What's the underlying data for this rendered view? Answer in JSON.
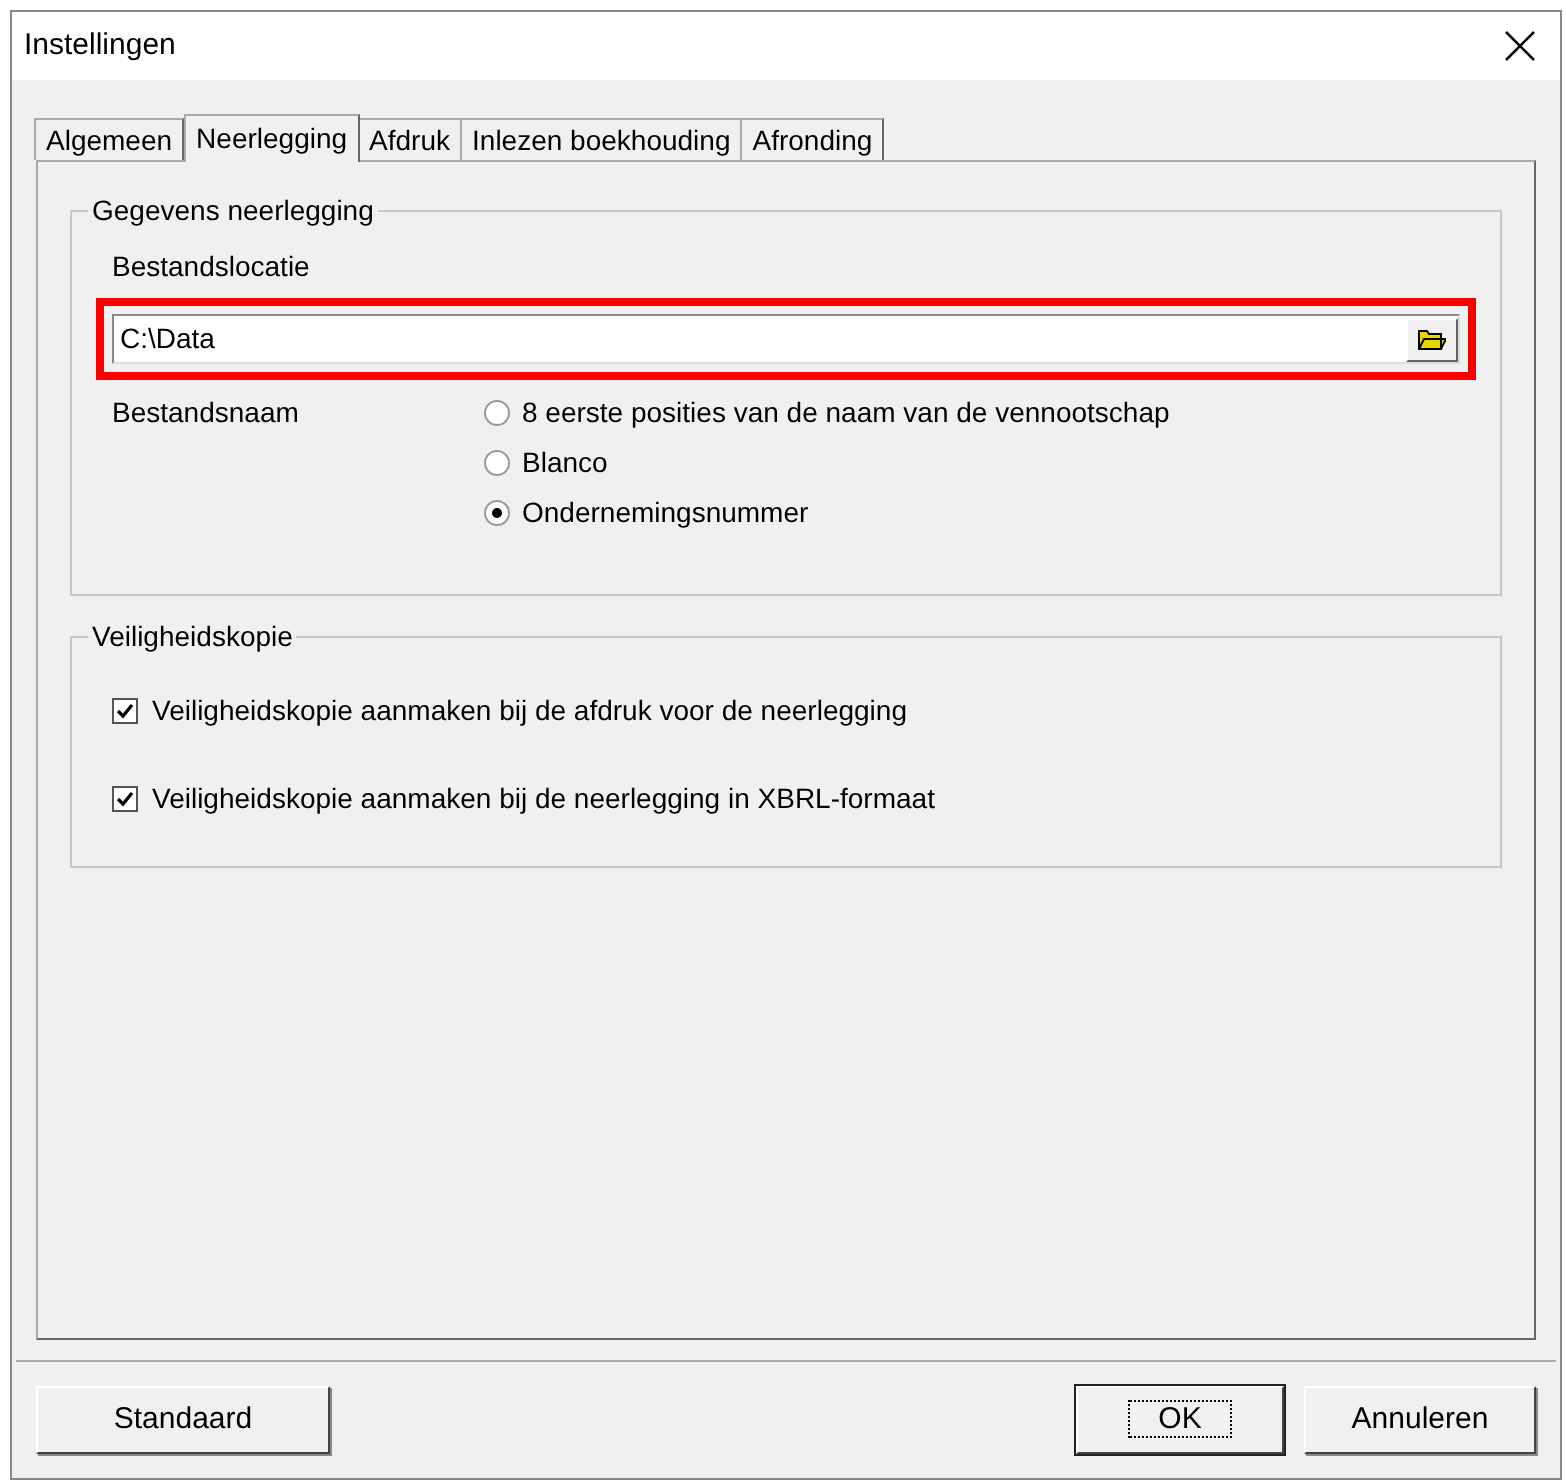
{
  "window": {
    "title": "Instellingen"
  },
  "tabs": [
    {
      "label": "Algemeen",
      "selected": false
    },
    {
      "label": "Neerlegging",
      "selected": true
    },
    {
      "label": "Afdruk",
      "selected": false
    },
    {
      "label": "Inlezen boekhouding",
      "selected": false
    },
    {
      "label": "Afronding",
      "selected": false
    }
  ],
  "group_1": {
    "title": "Gegevens neerlegging",
    "location_label": "Bestandslocatie",
    "location_field": {
      "value": "C:\\Data",
      "highlighted": true
    },
    "filename_label": "Bestandsnaam",
    "options": [
      {
        "label": "8 eerste posities van de naam van de vennootschap",
        "selected": false
      },
      {
        "label": "Blanco",
        "selected": false
      },
      {
        "label": "Ondernemingsnummer",
        "selected": true
      }
    ]
  },
  "group_2": {
    "title": "Veiligheidskopie",
    "checkboxes": [
      {
        "label": "Veiligheidskopie aanmaken bij de afdruk voor de neerlegging",
        "checked": true
      },
      {
        "label": "Veiligheidskopie aanmaken bij de neerlegging in XBRL-formaat",
        "checked": true
      }
    ]
  },
  "buttons": [
    {
      "label": "Standaard",
      "default": false
    },
    {
      "label": "OK",
      "default": true
    },
    {
      "label": "Annuleren",
      "default": false
    }
  ]
}
